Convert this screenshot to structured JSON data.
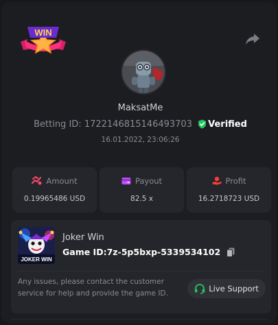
{
  "header": {
    "badge_text": "WIN",
    "share_icon": "share-icon"
  },
  "player": {
    "username": "MaksatMe",
    "betting_id_label": "Betting ID:",
    "betting_id": "1722146815146493703",
    "verified_label": "Verified",
    "date": "16.01.2022, 23:06:26"
  },
  "stats": [
    {
      "label": "Amount",
      "value": "0.19965486 USD",
      "icon": "amount-icon",
      "color": "#ff4d6d"
    },
    {
      "label": "Payout",
      "value": "82.5 x",
      "icon": "payout-icon",
      "color": "#c04dff"
    },
    {
      "label": "Profit",
      "value": "16.2718723 USD",
      "icon": "profit-icon",
      "color": "#ff3b3b"
    }
  ],
  "game": {
    "name": "Joker Win",
    "id_label": "Game ID:",
    "id_value": "7z-5p5bxp-5339534102",
    "thumb_text": "JOKER WIN",
    "notice": "Any issues, please contact the customer service for help and provide the game ID.",
    "support_label": "Live Support"
  },
  "colors": {
    "background": "#17181b",
    "panel": "#1c1d21",
    "card": "#25262b",
    "verified_green": "#22c55e",
    "support_green": "#22c55e"
  }
}
